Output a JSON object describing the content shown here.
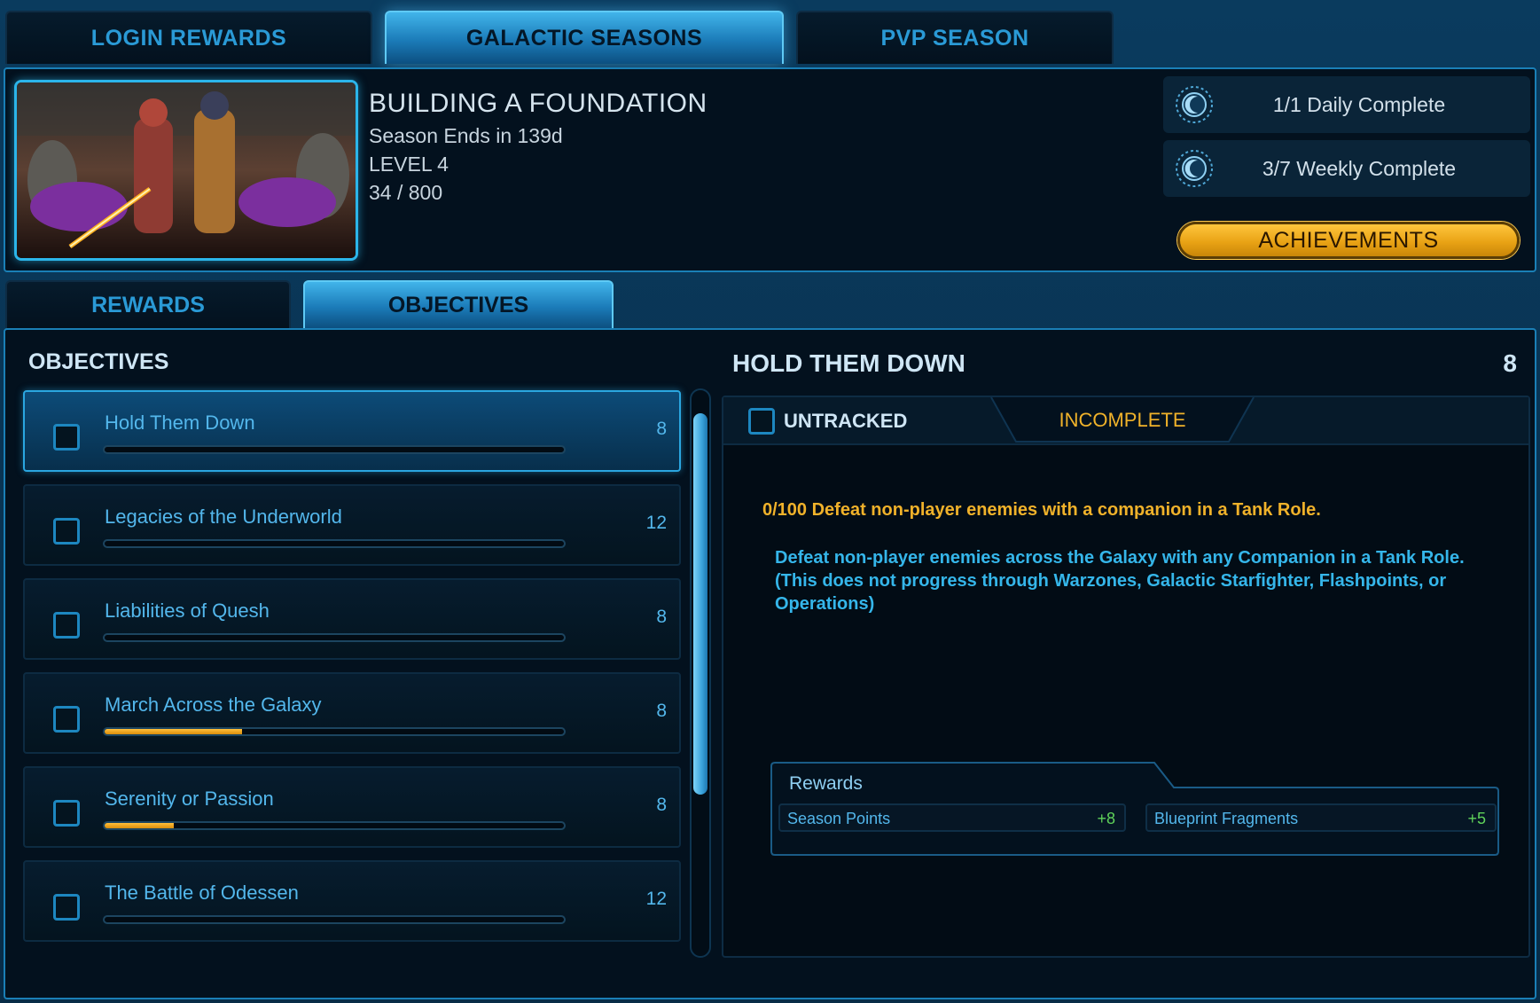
{
  "top_tabs": [
    {
      "label": "LOGIN REWARDS",
      "active": false
    },
    {
      "label": "GALACTIC SEASONS",
      "active": true
    },
    {
      "label": "PVP SEASON",
      "active": false
    }
  ],
  "season": {
    "title": "BUILDING A FOUNDATION",
    "ends": "Season Ends in 139d",
    "level": "LEVEL 4",
    "progress": "34 / 800"
  },
  "quests": {
    "daily": "1/1 Daily Complete",
    "weekly": "3/7 Weekly Complete"
  },
  "achievements_label": "ACHIEVEMENTS",
  "sub_tabs": [
    {
      "label": "REWARDS",
      "active": false
    },
    {
      "label": "OBJECTIVES",
      "active": true
    }
  ],
  "objectives": {
    "heading": "OBJECTIVES",
    "items": [
      {
        "name": "Hold Them Down",
        "value": "8",
        "progress": 0.0,
        "selected": true
      },
      {
        "name": "Legacies of the Underworld",
        "value": "12",
        "progress": 0.0,
        "selected": false
      },
      {
        "name": "Liabilities of Quesh",
        "value": "8",
        "progress": 0.0,
        "selected": false
      },
      {
        "name": "March Across the Galaxy",
        "value": "8",
        "progress": 0.3,
        "selected": false
      },
      {
        "name": "Serenity or Passion",
        "value": "8",
        "progress": 0.15,
        "selected": false
      },
      {
        "name": "The Battle of Odessen",
        "value": "12",
        "progress": 0.0,
        "selected": false
      }
    ]
  },
  "detail": {
    "title": "HOLD THEM DOWN",
    "points": "8",
    "tracking": "UNTRACKED",
    "status": "INCOMPLETE",
    "requirement": "0/100 Defeat non-player enemies with a companion in a Tank Role.",
    "description": "Defeat non-player enemies across the Galaxy with any Companion in a Tank Role. (This does not progress through Warzones, Galactic Starfighter, Flashpoints, or Operations)",
    "rewards_label": "Rewards",
    "rewards": [
      {
        "name": "Season Points",
        "value": "+8"
      },
      {
        "name": "Blueprint Fragments",
        "value": "+5"
      }
    ]
  },
  "colors": {
    "accent": "#2a9ad6",
    "gold": "#f0b22a",
    "reward_green": "#5fd25a"
  },
  "icons": {
    "quest": "sun-moon-icon",
    "checkbox": "checkbox-icon"
  }
}
